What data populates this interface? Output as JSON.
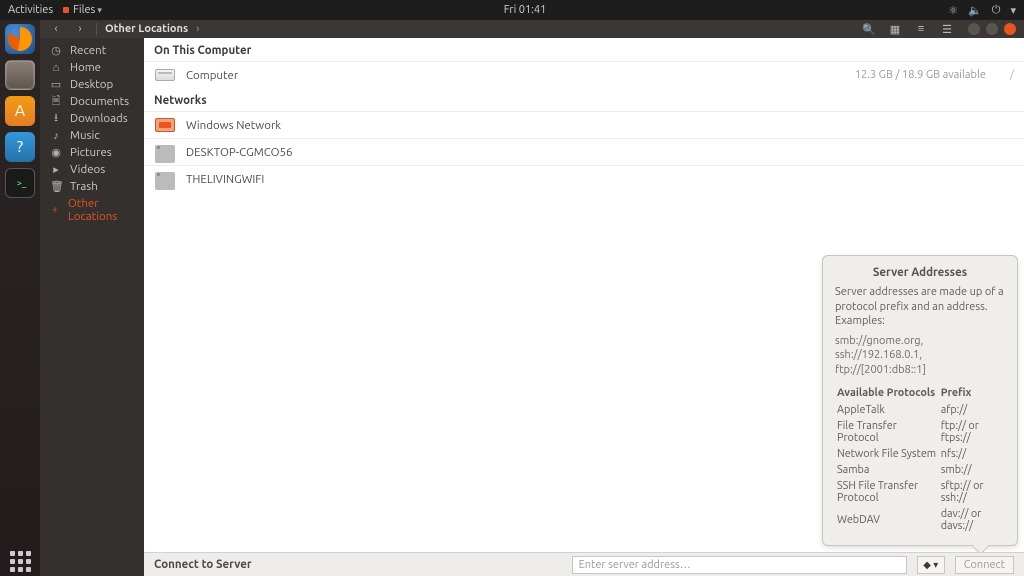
{
  "topbar": {
    "activities": "Activities",
    "app_menu": "Files",
    "clock": "Fri 01:41"
  },
  "titlebar": {
    "back_glyph": "‹",
    "fwd_glyph": "›",
    "location": "Other Locations",
    "caret": "›"
  },
  "sidebar": {
    "items": [
      {
        "icon": "◷",
        "label": "Recent"
      },
      {
        "icon": "⌂",
        "label": "Home"
      },
      {
        "icon": "▭",
        "label": "Desktop"
      },
      {
        "icon": "🗎",
        "label": "Documents"
      },
      {
        "icon": "⭳",
        "label": "Downloads"
      },
      {
        "icon": "♪",
        "label": "Music"
      },
      {
        "icon": "◉",
        "label": "Pictures"
      },
      {
        "icon": "▸",
        "label": "Videos"
      },
      {
        "icon": "🗑",
        "label": "Trash"
      }
    ],
    "other": {
      "icon": "+",
      "label": "Other Locations"
    }
  },
  "content": {
    "section_this": "On This Computer",
    "computer_row": {
      "label": "Computer",
      "used": "12.3 GB",
      "of": " / 18.9 GB available",
      "path": "/"
    },
    "section_net": "Networks",
    "net_items": [
      {
        "kind": "smb",
        "label": "Windows Network"
      },
      {
        "kind": "srv",
        "label": "DESKTOP-CGMCO56"
      },
      {
        "kind": "srv",
        "label": "THELIVINGWIFI"
      }
    ]
  },
  "connect": {
    "label": "Connect to Server",
    "placeholder": "Enter server address…",
    "hist_glyph": "◆ ▾",
    "button": "Connect"
  },
  "popover": {
    "title": "Server Addresses",
    "desc": "Server addresses are made up of a protocol prefix and an address. Examples:",
    "examples": "smb://gnome.org, ssh://192.168.0.1, ftp://[2001:db8::1]",
    "col_proto": "Available Protocols",
    "col_prefix": "Prefix",
    "rows": [
      {
        "p": "AppleTalk",
        "x": "afp://"
      },
      {
        "p": "File Transfer Protocol",
        "x": "ftp:// or ftps://"
      },
      {
        "p": "Network File System",
        "x": "nfs://"
      },
      {
        "p": "Samba",
        "x": "smb://"
      },
      {
        "p": "SSH File Transfer Protocol",
        "x": "sftp:// or ssh://"
      },
      {
        "p": "WebDAV",
        "x": "dav:// or davs://"
      }
    ]
  }
}
